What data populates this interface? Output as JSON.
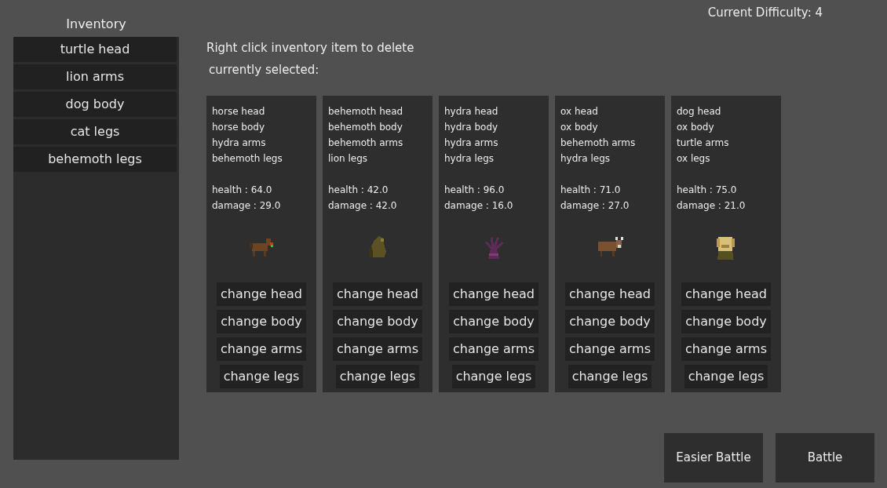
{
  "difficulty": "Current Difficulty: 4",
  "inventory": {
    "title": "Inventory",
    "items": [
      "turtle head",
      "lion arms",
      "dog body",
      "cat legs",
      "behemoth legs"
    ]
  },
  "instruction": "Right click inventory item to delete",
  "selection_label": "currently selected:",
  "creatures": [
    {
      "parts": [
        "horse head",
        "horse body",
        "hydra arms",
        "behemoth legs"
      ],
      "health": "health : 64.0",
      "damage": "damage : 29.0",
      "buttons": [
        "change head",
        "change body",
        "change arms",
        "change legs"
      ]
    },
    {
      "parts": [
        "behemoth head",
        "behemoth body",
        "behemoth arms",
        "lion legs"
      ],
      "health": "health : 42.0",
      "damage": "damage : 42.0",
      "buttons": [
        "change head",
        "change body",
        "change arms",
        "change legs"
      ]
    },
    {
      "parts": [
        "hydra head",
        "hydra body",
        "hydra arms",
        "hydra legs"
      ],
      "health": "health : 96.0",
      "damage": "damage : 16.0",
      "buttons": [
        "change head",
        "change body",
        "change arms",
        "change legs"
      ]
    },
    {
      "parts": [
        "ox head",
        "ox body",
        "behemoth arms",
        "hydra legs"
      ],
      "health": "health : 71.0",
      "damage": "damage : 27.0",
      "buttons": [
        "change head",
        "change body",
        "change arms",
        "change legs"
      ]
    },
    {
      "parts": [
        "dog head",
        "ox body",
        "turtle arms",
        "ox legs"
      ],
      "health": "health : 75.0",
      "damage": "damage : 21.0",
      "buttons": [
        "change head",
        "change body",
        "change arms",
        "change legs"
      ]
    }
  ],
  "actions": [
    "Easier Battle",
    "Battle"
  ]
}
